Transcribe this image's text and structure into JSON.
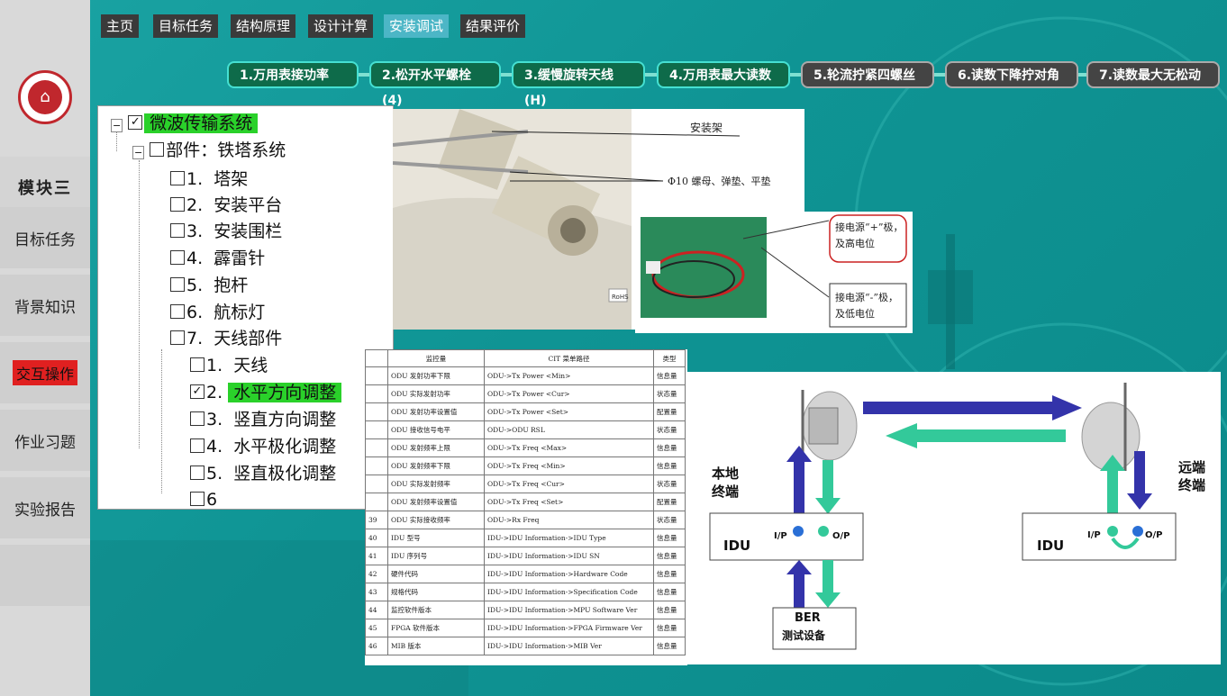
{
  "top_nav": [
    "主页",
    "目标任务",
    "结构原理",
    "设计计算",
    "安装调试",
    "结果评价"
  ],
  "top_nav_active": "安装调试",
  "steps": [
    {
      "label": "1.万用表接功率",
      "state": "done"
    },
    {
      "label": "2.松开水平螺栓(4)",
      "state": "done"
    },
    {
      "label": "3.缓慢旋转天线(H)",
      "state": "done"
    },
    {
      "label": "4.万用表最大读数",
      "state": "done"
    },
    {
      "label": "5.轮流拧紧四螺丝",
      "state": "pending"
    },
    {
      "label": "6.读数下降拧对角",
      "state": "pending"
    },
    {
      "label": "7.读数最大无松动",
      "state": "pending"
    }
  ],
  "sidebar": {
    "module_title": "模块三",
    "items": [
      "目标任务",
      "背景知识",
      "交互操作",
      "作业习题",
      "实验报告"
    ],
    "active": "交互操作"
  },
  "tree": {
    "root": "微波传输系统",
    "part": "部件：铁塔系统",
    "items": [
      {
        "num": "1.",
        "label": "塔架"
      },
      {
        "num": "2.",
        "label": "安装平台"
      },
      {
        "num": "3.",
        "label": "安装围栏"
      },
      {
        "num": "4.",
        "label": "霹雷针"
      },
      {
        "num": "5.",
        "label": "抱杆"
      },
      {
        "num": "6.",
        "label": "航标灯"
      },
      {
        "num": "7.",
        "label": "天线部件"
      }
    ],
    "sub_items": [
      {
        "num": "1.",
        "label": "天线",
        "checked": false
      },
      {
        "num": "2.",
        "label": "水平方向调整",
        "checked": true
      },
      {
        "num": "3.",
        "label": "竖直方向调整",
        "checked": false
      },
      {
        "num": "4.",
        "label": "水平极化调整",
        "checked": false
      },
      {
        "num": "5.",
        "label": "竖直极化调整",
        "checked": false
      },
      {
        "num": "6",
        "label": "",
        "checked": false
      }
    ]
  },
  "photo_labels": {
    "mount": "安装架",
    "bolts": "Φ10 螺母、弹垫、平垫",
    "pos": "接电源“+”极，及高电位",
    "neg": "接电源“-”极，及低电位",
    "rohs": "RoHS"
  },
  "cit_table": {
    "headers": [
      "",
      "监控量",
      "CIT 菜单路径",
      "类型"
    ],
    "rows": [
      [
        "",
        "ODU 发射功率下限",
        "ODU->Tx Power <Min>",
        "信息量"
      ],
      [
        "",
        "ODU 实际发射功率",
        "ODU->Tx Power <Cur>",
        "状态量"
      ],
      [
        "",
        "ODU 发射功率设置值",
        "ODU->Tx Power <Set>",
        "配置量"
      ],
      [
        "",
        "ODU 接收信号电平",
        "ODU->ODU RSL",
        "状态量"
      ],
      [
        "",
        "ODU 发射频率上限",
        "ODU->Tx Freq <Max>",
        "信息量"
      ],
      [
        "",
        "ODU 发射频率下限",
        "ODU->Tx Freq <Min>",
        "信息量"
      ],
      [
        "",
        "ODU 实际发射频率",
        "ODU->Tx Freq <Cur>",
        "状态量"
      ],
      [
        "",
        "ODU 发射频率设置值",
        "ODU->Tx Freq <Set>",
        "配置量"
      ],
      [
        "39",
        "ODU 实际接收频率",
        "ODU->Rx Freq",
        "状态量"
      ],
      [
        "40",
        "IDU 型号",
        "IDU->IDU Information->IDU Type",
        "信息量"
      ],
      [
        "41",
        "IDU 序列号",
        "IDU->IDU Information->IDU SN",
        "信息量"
      ],
      [
        "42",
        "硬件代码",
        "IDU->IDU Information->Hardware Code",
        "信息量"
      ],
      [
        "43",
        "规格代码",
        "IDU->IDU Information->Specification Code",
        "信息量"
      ],
      [
        "44",
        "监控软件版本",
        "IDU->IDU Information->MPU Software Ver",
        "信息量"
      ],
      [
        "45",
        "FPGA 软件版本",
        "IDU->IDU Information->FPGA Firmware Ver",
        "信息量"
      ],
      [
        "46",
        "MIB 版本",
        "IDU->IDU Information->MIB Ver",
        "信息量"
      ]
    ]
  },
  "diagram": {
    "local": "本地终端",
    "remote": "远端终端",
    "idu_local": "IDU",
    "idu_remote": "IDU",
    "ip": "I/P",
    "op": "O/P",
    "ber_line1": "BER",
    "ber_line2": "测试设备"
  },
  "colors": {
    "background": "#0f9494",
    "active_tab": "#4cb6c6",
    "step_done": "#0e6b4a",
    "step_pending": "#444444",
    "highlight": "#2ad12a",
    "arrow_blue": "#3333aa",
    "arrow_green": "#33c99a"
  }
}
